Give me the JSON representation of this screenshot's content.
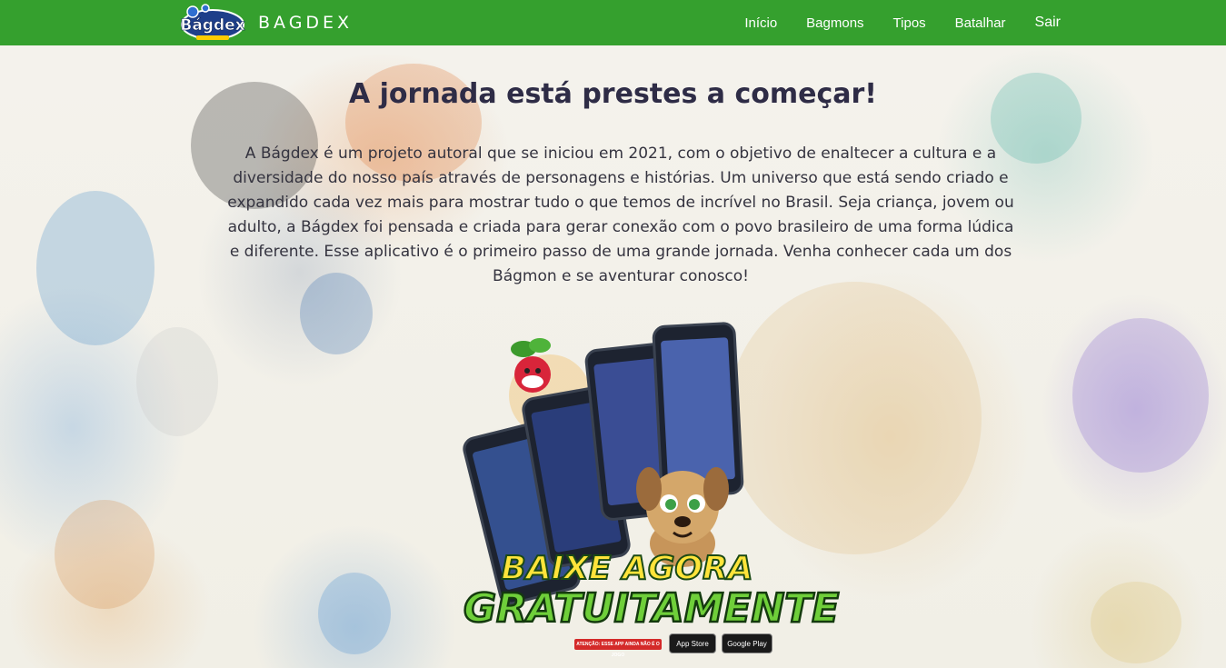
{
  "navbar": {
    "brand_name": "BAGDEX",
    "logo_icon": "bagdex-logo-icon",
    "links": [
      {
        "label": "Início"
      },
      {
        "label": "Bagmons"
      },
      {
        "label": "Tipos"
      },
      {
        "label": "Batalhar"
      },
      {
        "label": "Sair"
      }
    ],
    "color": "#35a02e"
  },
  "main": {
    "title": "A jornada está prestes a começar!",
    "intro": "A Bágdex é um projeto autoral que se iniciou em 2021, com o objetivo de enaltecer a cultura e a diversidade do nosso país através de personagens e histórias. Um universo que está sendo criado e expandido cada vez mais para mostrar tudo o que temos de incrível no Brasil. Seja criança, jovem ou adulto, a Bágdex foi pensada e criada para gerar conexão com o povo brasileiro de uma forma lúdica e diferente. Esse aplicativo é o primeiro passo de uma grande jornada. Venha conhecer cada um dos Bágmon e se aventurar conosco!"
  },
  "promo": {
    "line1": "BAIXE AGORA",
    "line2": "GRATUITAMENTE",
    "warning": "ATENÇÃO: ESSE APP AINDA NÃO É O JOGO",
    "app_store": "App Store",
    "google_play": "Google Play"
  }
}
